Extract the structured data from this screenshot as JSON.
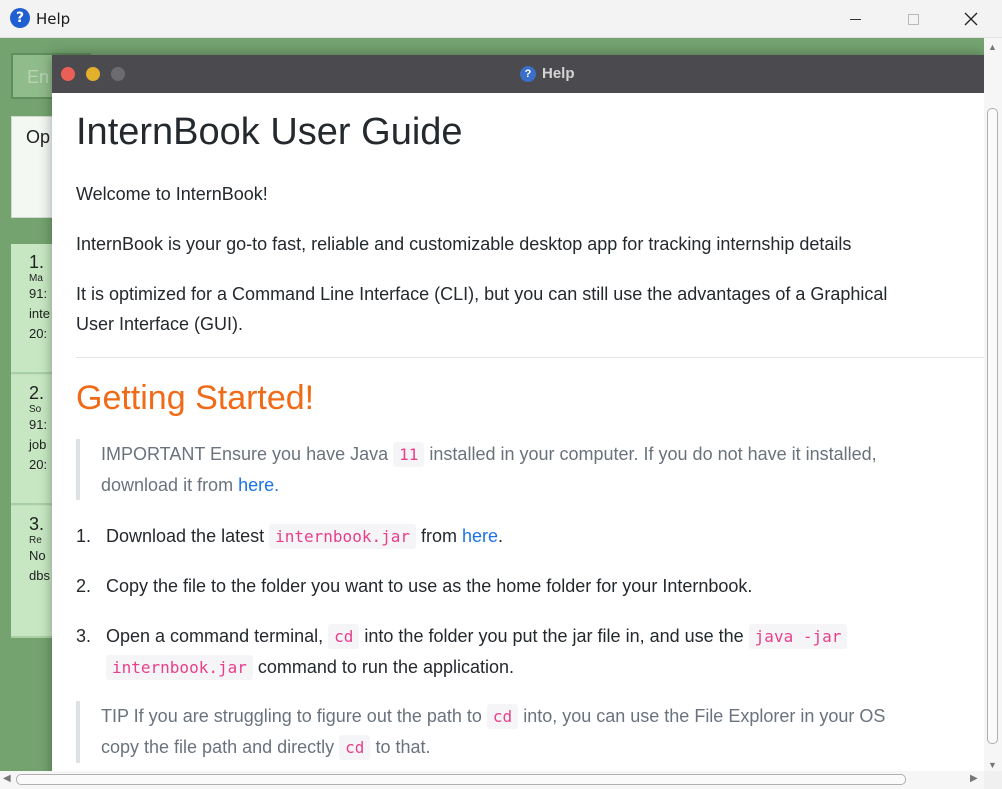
{
  "window": {
    "title": "Help",
    "icon_glyph": "?"
  },
  "background_app": {
    "command_text": "En",
    "result_text": "Op",
    "cards": [
      {
        "number": "1.",
        "tag": "Ma",
        "lines": [
          "91:",
          "inte",
          "20:"
        ]
      },
      {
        "number": "2.",
        "tag": "So",
        "lines": [
          "91:",
          "job",
          "20:"
        ]
      },
      {
        "number": "3.",
        "tag": "Re",
        "lines": [
          "No",
          "dbs"
        ]
      }
    ]
  },
  "help_window": {
    "title": "Help",
    "icon_glyph": "?"
  },
  "guide": {
    "title": "InternBook User Guide",
    "welcome": "Welcome to InternBook!",
    "intro": "InternBook is your go-to fast, reliable and customizable desktop app for tracking internship details",
    "cli_line1": "It is optimized for a Command Line Interface (CLI), but you can still use the advantages of a Graphical",
    "cli_line2": "User Interface (GUI).",
    "section_title": "Getting Started!",
    "important": {
      "prefix": "IMPORTANT Ensure you have Java",
      "code": "11",
      "suffix": "installed in your computer. If you do not have it installed,",
      "line2_prefix": "download it from",
      "link": "here."
    },
    "steps": [
      {
        "number": "1.",
        "prefix": "Download the latest",
        "code": "internbook.jar",
        "middle": "from",
        "link": "here",
        "suffix": "."
      },
      {
        "number": "2.",
        "text": "Copy the file to the folder you want to use as the home folder for your Internbook."
      },
      {
        "number": "3.",
        "prefix": "Open a command terminal,",
        "code1": "cd",
        "middle": "into the folder you put the jar file in, and use the",
        "code2": "java -jar",
        "code3": "internbook.jar",
        "suffix": "command to run the application."
      }
    ],
    "tip": {
      "prefix": "TIP If you are struggling to figure out the path to",
      "code1": "cd",
      "suffix": "into, you can use the File Explorer in your OS",
      "line2_prefix": "copy the file path and directly",
      "code2": "cd",
      "line2_suffix": "to that."
    }
  },
  "colors": {
    "accent_heading": "#f06b18",
    "link": "#1a73e8",
    "code": "#e83e8c",
    "background_app": "#74a36f"
  }
}
